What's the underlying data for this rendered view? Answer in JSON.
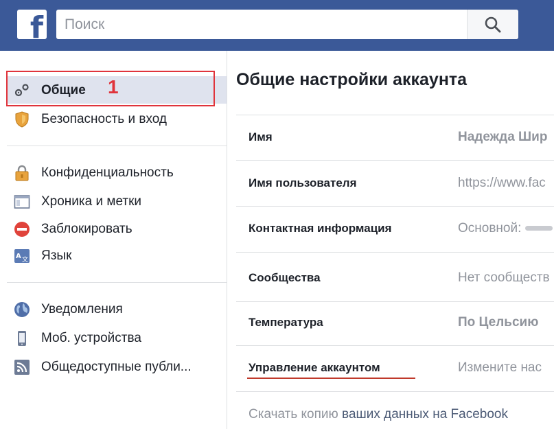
{
  "header": {
    "logo_letter": "f",
    "search_placeholder": "Поиск"
  },
  "sidebar": {
    "annotation_number": "1",
    "groups": [
      [
        {
          "label": "Общие",
          "icon": "gears-icon",
          "active": true
        },
        {
          "label": "Безопасность и вход",
          "icon": "shield-icon"
        }
      ],
      [
        {
          "label": "Конфиденциальность",
          "icon": "padlock-icon"
        },
        {
          "label": "Хроника и метки",
          "icon": "timeline-icon"
        },
        {
          "label": "Заблокировать",
          "icon": "block-icon"
        },
        {
          "label": "Язык",
          "icon": "language-icon"
        }
      ],
      [
        {
          "label": "Уведомления",
          "icon": "globe-icon"
        },
        {
          "label": "Моб. устройства",
          "icon": "mobile-icon"
        },
        {
          "label": "Общедоступные публи...",
          "icon": "rss-icon"
        }
      ]
    ]
  },
  "main": {
    "title": "Общие настройки аккаунта",
    "rows": [
      {
        "label": "Имя",
        "value": "Надежда Шир"
      },
      {
        "label": "Имя пользователя",
        "value": "https://www.fac"
      },
      {
        "label": "Контактная информация",
        "value": "Основной:"
      },
      {
        "label": "Сообщества",
        "value": "Нет сообществ"
      },
      {
        "label": "Температура",
        "value": "По Цельсию"
      },
      {
        "label": "Управление аккаунтом",
        "value": "Измените нас"
      }
    ],
    "download_part1": "Скачать копию",
    "download_part2": " ваших данных на Facebook"
  },
  "colors": {
    "brand": "#3b5998",
    "highlight": "#e0343b",
    "active_bg": "#dfe3ee"
  }
}
